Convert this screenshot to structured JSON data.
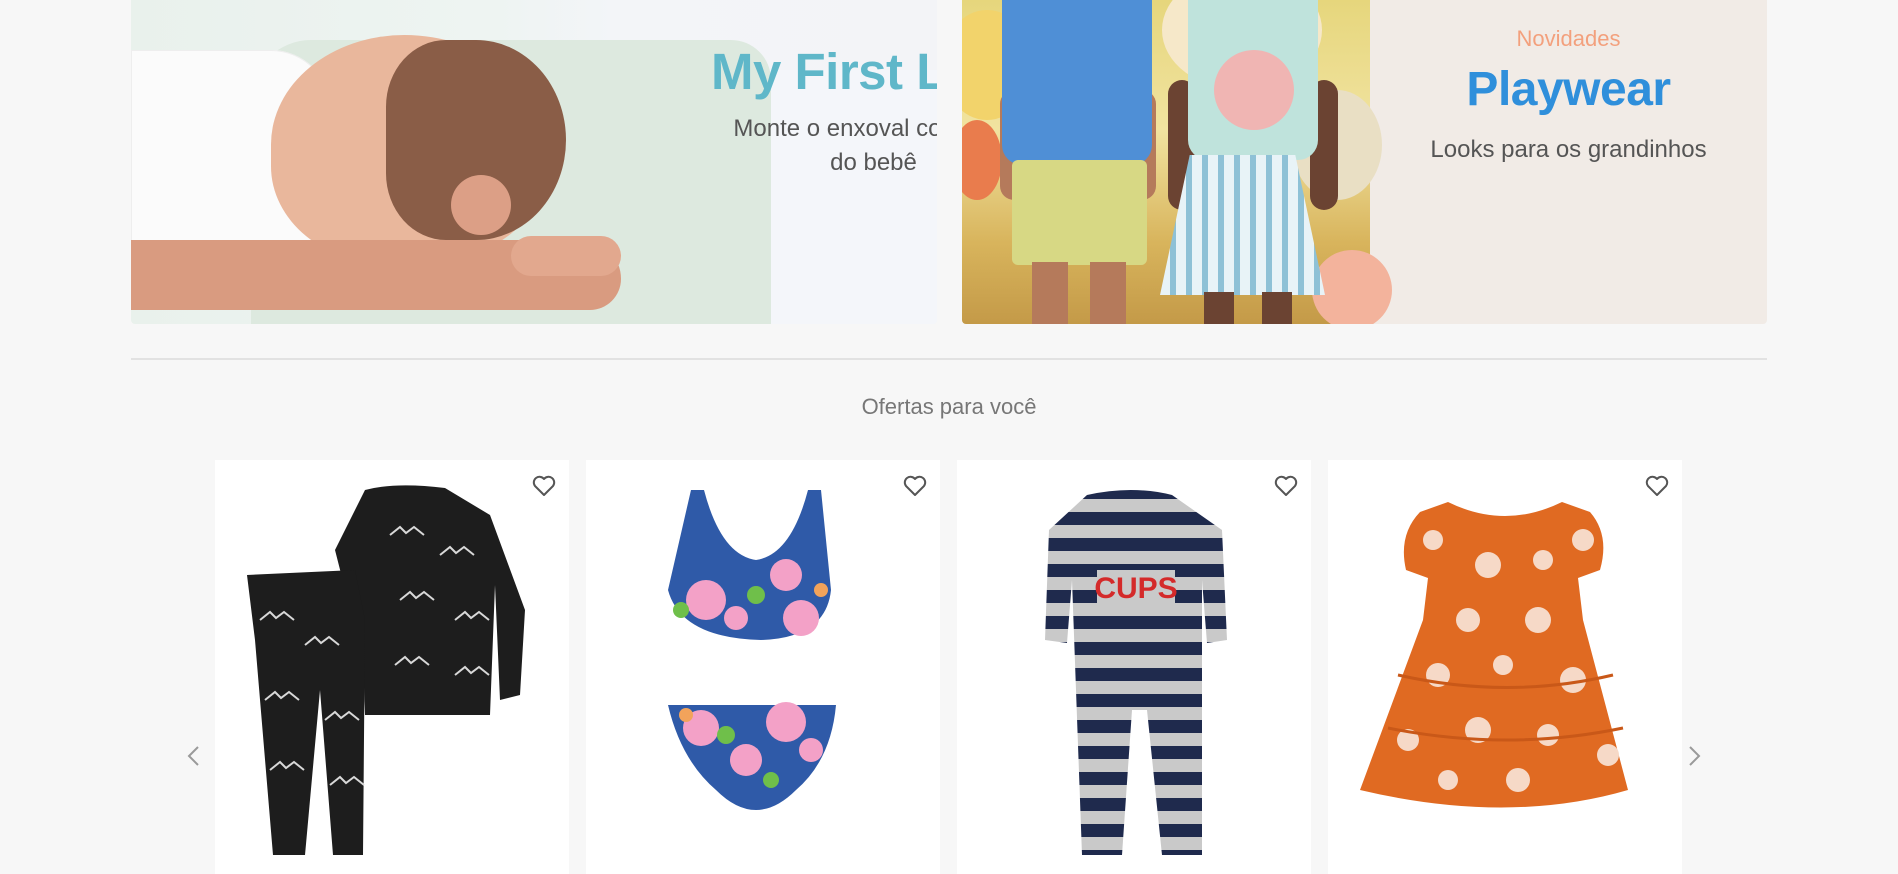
{
  "banners": [
    {
      "title": "My First Love",
      "subtitle": "Monte o enxoval completo do bebê",
      "title_color": "#5fb7c9"
    },
    {
      "kicker": "Novidades",
      "title": "Playwear",
      "subtitle": "Looks para os grandinhos",
      "kicker_color": "#f3a07d",
      "title_color": "#2f8fdb"
    }
  ],
  "offers": {
    "title": "Ofertas para você",
    "prev_icon": "chevron-left-icon",
    "next_icon": "chevron-right-icon",
    "products": [
      {
        "image": "black-bat-print-pajama-set",
        "favorite_icon": "heart-outline-icon"
      },
      {
        "image": "floral-bikini-set",
        "favorite_icon": "heart-outline-icon"
      },
      {
        "image": "striped-footed-sleeper",
        "favorite_icon": "heart-outline-icon",
        "print_text": "CUPS"
      },
      {
        "image": "orange-floral-dress",
        "favorite_icon": "heart-outline-icon"
      }
    ]
  }
}
